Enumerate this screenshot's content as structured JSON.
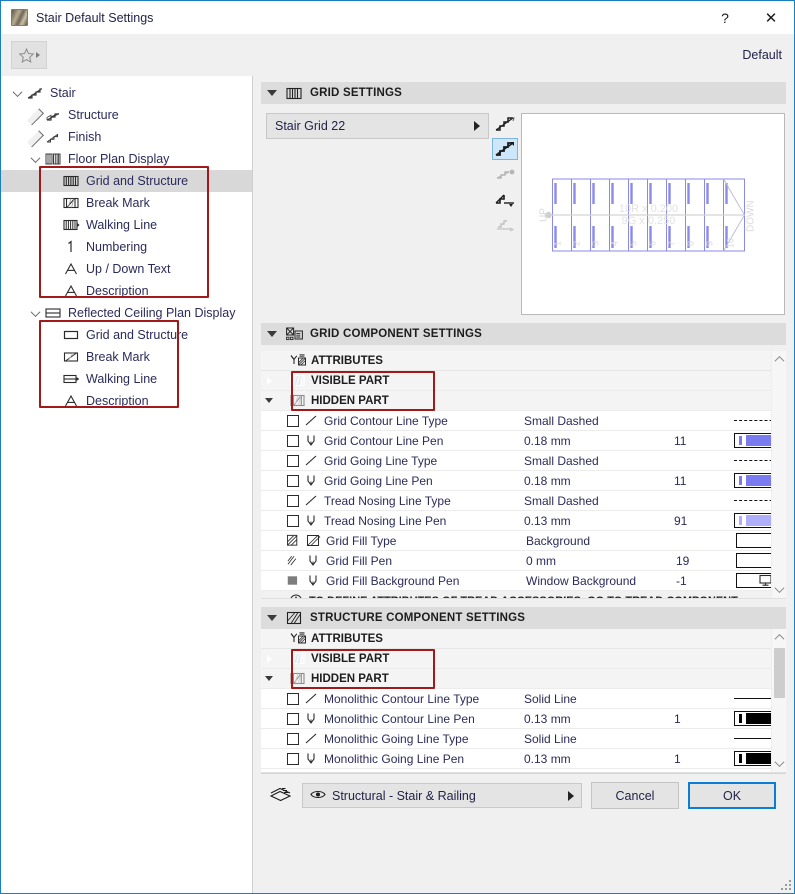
{
  "window": {
    "title": "Stair Default Settings",
    "help_label": "?",
    "close_label": "✕",
    "app_icon": "stair-icon"
  },
  "toolbar": {
    "favorites_icon": "star-icon",
    "favorites_arrow_icon": "triangle-right-icon",
    "default_label": "Default"
  },
  "sidebar": {
    "items": [
      {
        "label": "Stair",
        "icon": "stair-icon",
        "depth": 0,
        "twisty": "down",
        "selected": false
      },
      {
        "label": "Structure",
        "icon": "structure-icon",
        "depth": 1,
        "twisty": "right",
        "selected": false
      },
      {
        "label": "Finish",
        "icon": "finish-icon",
        "depth": 1,
        "twisty": "right",
        "selected": false
      },
      {
        "label": "Floor Plan Display",
        "icon": "floor-plan-icon",
        "depth": 1,
        "twisty": "down",
        "selected": false
      },
      {
        "label": "Grid and Structure",
        "icon": "grid-structure-icon",
        "depth": 2,
        "twisty": "none",
        "selected": true
      },
      {
        "label": "Break Mark",
        "icon": "break-mark-icon",
        "depth": 2,
        "twisty": "none",
        "selected": false
      },
      {
        "label": "Walking Line",
        "icon": "walking-line-icon",
        "depth": 2,
        "twisty": "none",
        "selected": false
      },
      {
        "label": "Numbering",
        "icon": "numbering-icon",
        "depth": 2,
        "twisty": "none",
        "selected": false
      },
      {
        "label": "Up / Down Text",
        "icon": "text-icon",
        "depth": 2,
        "twisty": "none",
        "selected": false
      },
      {
        "label": "Description",
        "icon": "text-icon",
        "depth": 2,
        "twisty": "none",
        "selected": false
      },
      {
        "label": "Reflected Ceiling Plan Display",
        "icon": "rcp-icon",
        "depth": 1,
        "twisty": "down",
        "selected": false
      },
      {
        "label": "Grid and Structure",
        "icon": "rect-icon",
        "depth": 2,
        "twisty": "none",
        "selected": false
      },
      {
        "label": "Break Mark",
        "icon": "break-mark-rcp-icon",
        "depth": 2,
        "twisty": "none",
        "selected": false
      },
      {
        "label": "Walking Line",
        "icon": "walking-line-rcp-icon",
        "depth": 2,
        "twisty": "none",
        "selected": false
      },
      {
        "label": "Description",
        "icon": "text-icon",
        "depth": 2,
        "twisty": "none",
        "selected": false
      }
    ]
  },
  "grid_settings": {
    "header": "GRID SETTINGS",
    "header_icon": "grid-icon",
    "combo_value": "Stair Grid 22",
    "view_tools": [
      {
        "name": "stair-view-3d-icon",
        "selected": false,
        "enabled": true
      },
      {
        "name": "stair-view-plan-icon",
        "selected": true,
        "enabled": true
      },
      {
        "name": "stair-view-node-icon",
        "selected": false,
        "enabled": false
      },
      {
        "name": "stair-view-section-icon",
        "selected": false,
        "enabled": true
      },
      {
        "name": "stair-view-elevation-icon",
        "selected": false,
        "enabled": false
      }
    ],
    "preview": {
      "up_label": "UP",
      "down_label": "DOWN",
      "riser_text": "10R x 0.200",
      "going_text": "9G x 0.250",
      "tread_numbers": [
        "1",
        "2",
        "3",
        "4",
        "5",
        "6",
        "7",
        "8",
        "9",
        "10"
      ]
    }
  },
  "grid_component": {
    "header": "GRID COMPONENT SETTINGS",
    "header_icon": "grid-component-icon",
    "attributes_label": "ATTRIBUTES",
    "attributes_icon": "attributes-icon",
    "groups": [
      {
        "label": "VISIBLE PART",
        "icon": "visible-part-icon",
        "state": "collapsed",
        "selected": true
      },
      {
        "label": "HIDDEN PART",
        "icon": "hidden-part-icon",
        "state": "expanded",
        "selected": false
      }
    ],
    "rows": [
      {
        "name": "Grid Contour Line Type",
        "value": "Small Dashed",
        "pen": "",
        "icon": "line-type-icon",
        "swatch": "dashed"
      },
      {
        "name": "Grid Contour Line Pen",
        "value": "0.18 mm",
        "pen": "11",
        "icon": "pen-icon",
        "swatch": "pen",
        "color": "#7b7bf0"
      },
      {
        "name": "Grid Going Line Type",
        "value": "Small Dashed",
        "pen": "",
        "icon": "line-type-icon",
        "swatch": "dashed"
      },
      {
        "name": "Grid Going Line Pen",
        "value": "0.18 mm",
        "pen": "11",
        "icon": "pen-icon",
        "swatch": "pen",
        "color": "#7b7bf0"
      },
      {
        "name": "Tread Nosing Line Type",
        "value": "Small Dashed",
        "pen": "",
        "icon": "line-type-icon",
        "swatch": "dashed"
      },
      {
        "name": "Tread Nosing Line Pen",
        "value": "0.13 mm",
        "pen": "91",
        "icon": "pen-icon",
        "swatch": "pen",
        "color": "#aeaefb"
      },
      {
        "name": "Grid Fill Type",
        "value": "Background",
        "pen": "",
        "icon": "fill-type-icon",
        "swatch": "empty"
      },
      {
        "name": "Grid Fill Pen",
        "value": "0 mm",
        "pen": "19",
        "icon": "fill-pen-icon",
        "swatch": "empty"
      },
      {
        "name": "Grid Fill Background Pen",
        "value": "Window Background",
        "pen": "-1",
        "icon": "fill-bg-icon",
        "swatch": "monitor"
      }
    ],
    "info_text": "TO DEFINE ATTRIBUTES OF TREAD ACCESSORIES, GO TO TREAD COMPONENT ...",
    "info_icon": "info-icon"
  },
  "structure_component": {
    "header": "STRUCTURE COMPONENT SETTINGS",
    "header_icon": "structure-component-icon",
    "attributes_label": "ATTRIBUTES",
    "attributes_icon": "attributes-icon",
    "groups": [
      {
        "label": "VISIBLE PART",
        "icon": "visible-part-icon",
        "state": "collapsed",
        "selected": true
      },
      {
        "label": "HIDDEN PART",
        "icon": "hidden-part-icon",
        "state": "expanded",
        "selected": false
      }
    ],
    "rows": [
      {
        "name": "Monolithic Contour Line Type",
        "value": "Solid Line",
        "pen": "",
        "icon": "line-type-icon",
        "swatch": "solid"
      },
      {
        "name": "Monolithic Contour Line Pen",
        "value": "0.13 mm",
        "pen": "1",
        "icon": "pen-icon",
        "swatch": "pen",
        "color": "#000000"
      },
      {
        "name": "Monolithic Going Line Type",
        "value": "Solid Line",
        "pen": "",
        "icon": "line-type-icon",
        "swatch": "solid"
      },
      {
        "name": "Monolithic Going Line Pen",
        "value": "0.13 mm",
        "pen": "1",
        "icon": "pen-icon",
        "swatch": "pen",
        "color": "#000000"
      }
    ]
  },
  "footer": {
    "layers_icon": "layers-icon",
    "layer_eye_icon": "eye-icon",
    "layer_value": "Structural - Stair & Railing",
    "cancel_label": "Cancel",
    "ok_label": "OK"
  },
  "colors": {
    "accent": "#0a7ed4",
    "annotation": "#a31818",
    "header_bar": "#dcdcdc",
    "pen_blue": "#7b7bf0",
    "pen_light_blue": "#aeaefb"
  }
}
